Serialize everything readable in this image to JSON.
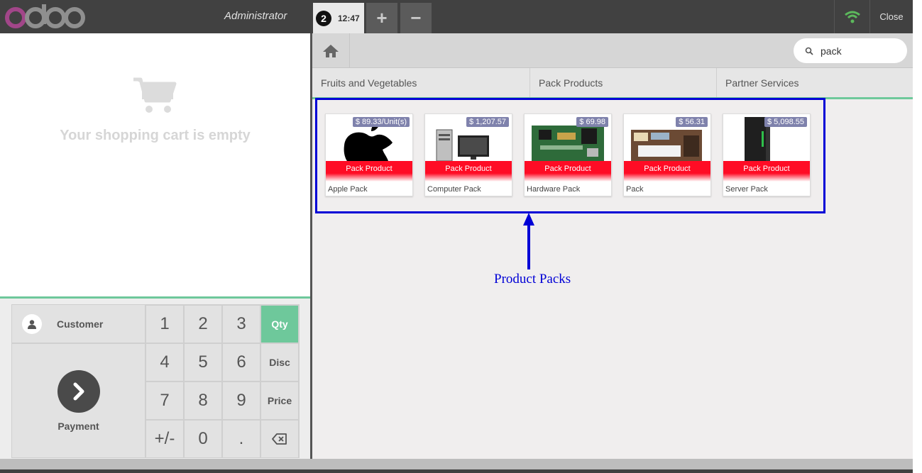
{
  "header": {
    "brand": "odoo",
    "user": "Administrator",
    "order_number": "2",
    "order_time": "12:47",
    "add_label": "+",
    "remove_label": "−",
    "close_label": "Close",
    "accent_color": "#6ec89b"
  },
  "cart": {
    "empty_text": "Your shopping cart is empty"
  },
  "actionpad": {
    "customer_label": "Customer",
    "payment_label": "Payment"
  },
  "numpad": {
    "keys": [
      "1",
      "2",
      "3",
      "4",
      "5",
      "6",
      "7",
      "8",
      "9",
      "+/-",
      "0",
      "."
    ],
    "modes": [
      "Qty",
      "Disc",
      "Price"
    ],
    "active_mode": "Qty",
    "backspace_icon": "backspace-icon"
  },
  "search": {
    "value": "pack"
  },
  "categories": [
    "Fruits and Vegetables",
    "Pack Products",
    "Partner Services"
  ],
  "products": [
    {
      "name": "Apple Pack",
      "price": "$ 89.33/Unit(s)",
      "ribbon": "Pack Product"
    },
    {
      "name": "Computer Pack",
      "price": "$ 1,207.57",
      "ribbon": "Pack Product"
    },
    {
      "name": "Hardware Pack",
      "price": "$ 69.98",
      "ribbon": "Pack Product"
    },
    {
      "name": "Pack",
      "price": "$ 56.31",
      "ribbon": "Pack Product"
    },
    {
      "name": "Server Pack",
      "price": "$ 5,098.55",
      "ribbon": "Pack Product"
    }
  ],
  "annotation": {
    "label": "Product Packs",
    "color": "#0000d6"
  }
}
